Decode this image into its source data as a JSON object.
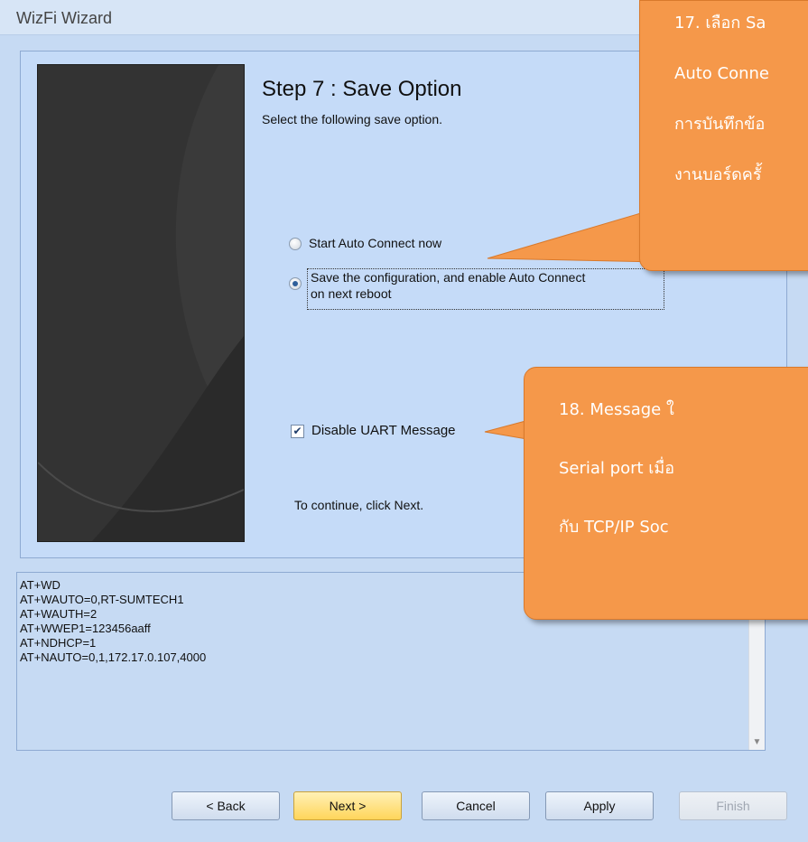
{
  "window": {
    "title": "WizFi Wizard"
  },
  "step": {
    "title": "Step 7 : Save Option",
    "subtitle": "Select the following save option."
  },
  "options": {
    "start_auto_connect": "Start Auto Connect now",
    "save_line1": "Save the configuration, and enable Auto Connect",
    "save_line2": "on next reboot",
    "selected": "save"
  },
  "disable_uart": {
    "label": "Disable UART Message",
    "checked": true
  },
  "continue_hint": "To continue, click Next.",
  "log_lines": [
    "AT+WD",
    "AT+WAUTO=0,RT-SUMTECH1",
    "AT+WAUTH=2",
    "AT+WWEP1=123456aaff",
    "AT+NDHCP=1",
    "AT+NAUTO=0,1,172.17.0.107,4000"
  ],
  "buttons": {
    "back": "< Back",
    "next": "Next >",
    "cancel": "Cancel",
    "apply": "Apply",
    "finish": "Finish"
  },
  "callouts": {
    "c17": [
      "17. เลือก Sa",
      "Auto Conne",
      "การบันทึกข้อ",
      "งานบอร์ดครั้"
    ],
    "c18": [
      "18. Message ใ",
      "Serial port เมื่อ",
      "กับ TCP/IP Soc"
    ]
  },
  "colors": {
    "callout": "#f5984a",
    "next_button": "#ffd55a",
    "panel": "#c5dbf8"
  }
}
